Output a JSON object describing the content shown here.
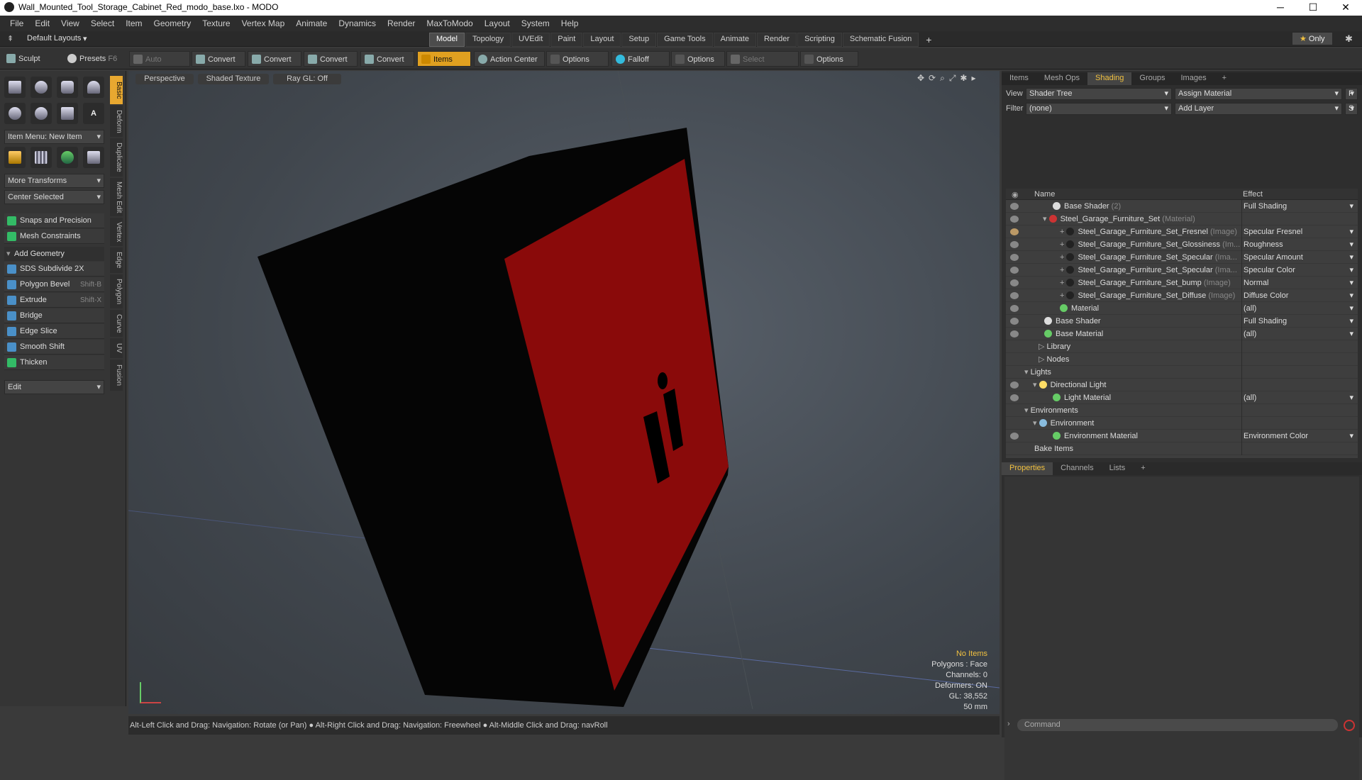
{
  "window": {
    "title": "Wall_Mounted_Tool_Storage_Cabinet_Red_modo_base.lxo - MODO",
    "minimize": "─",
    "maximize": "☐",
    "close": "✕"
  },
  "menubar": [
    "File",
    "Edit",
    "View",
    "Select",
    "Item",
    "Geometry",
    "Texture",
    "Vertex Map",
    "Animate",
    "Dynamics",
    "Render",
    "MaxToModo",
    "Layout",
    "System",
    "Help"
  ],
  "layoutbar": {
    "layouts_label": "Default Layouts",
    "tabs": [
      "Model",
      "Topology",
      "UVEdit",
      "Paint",
      "Layout",
      "Setup",
      "Game Tools",
      "Animate",
      "Render",
      "Scripting",
      "Schematic Fusion"
    ],
    "add": "+",
    "only": "Only"
  },
  "toolbar": {
    "sculpt": "Sculpt",
    "presets": "Presets",
    "presets_key": "F6",
    "auto_select": "Auto Select",
    "convert": "Convert",
    "items": "Items",
    "action_center": "Action Center",
    "options": "Options",
    "falloff": "Falloff",
    "select_through": "Select Through"
  },
  "leftpanel": {
    "vtabs": [
      "Basic",
      "Deform",
      "Duplicate",
      "Mesh Edit",
      "Vertex",
      "Edge",
      "Polygon",
      "Curve",
      "UV",
      "Fusion"
    ],
    "item_menu": "Item Menu: New Item",
    "more_transforms": "More Transforms",
    "center_selected": "Center Selected",
    "snaps": "Snaps and Precision",
    "mesh_constraints": "Mesh Constraints",
    "add_geometry": "Add Geometry",
    "tools": [
      {
        "label": "SDS Subdivide 2X",
        "key": ""
      },
      {
        "label": "Polygon Bevel",
        "key": "Shift-B"
      },
      {
        "label": "Extrude",
        "key": "Shift-X"
      },
      {
        "label": "Bridge",
        "key": ""
      },
      {
        "label": "Edge Slice",
        "key": ""
      },
      {
        "label": "Smooth Shift",
        "key": ""
      },
      {
        "label": "Thicken",
        "key": ""
      }
    ],
    "edit": "Edit"
  },
  "viewport": {
    "perspective": "Perspective",
    "shading": "Shaded Texture",
    "raygl": "Ray GL: Off",
    "info": [
      "No Items",
      "Polygons : Face",
      "Channels: 0",
      "Deformers: ON",
      "GL: 38,552",
      "50 mm"
    ],
    "colors": {
      "cabinet_body": "#050505",
      "door": "#8a0a0a"
    }
  },
  "status": "Alt-Left Click and Drag: Navigation: Rotate (or Pan) ● Alt-Right Click and Drag: Navigation: Freewheel ● Alt-Middle Click and Drag: navRoll",
  "rightpanel": {
    "tabs": [
      "Items",
      "Mesh Ops",
      "Shading",
      "Groups",
      "Images",
      "+"
    ],
    "view_label": "View",
    "view_value": "Shader Tree",
    "assign": "Assign Material",
    "f": "F",
    "filter_label": "Filter",
    "filter_value": "(none)",
    "add_layer": "Add Layer",
    "s": "S",
    "col_name": "Name",
    "col_effect": "Effect",
    "rows": [
      {
        "name": "Base Shader",
        "sub": "(2)",
        "effect": "Full Shading",
        "ball": "#ddd"
      },
      {
        "name": "Steel_Garage_Furniture_Set",
        "sub": "(Material)",
        "effect": "",
        "ball": "#c33"
      },
      {
        "name": "Steel_Garage_Furniture_Set_Fresnel",
        "sub": "(Image)",
        "effect": "Specular Fresnel",
        "ball": "#222"
      },
      {
        "name": "Steel_Garage_Furniture_Set_Glossiness",
        "sub": "(Im...",
        "effect": "Roughness",
        "ball": "#222"
      },
      {
        "name": "Steel_Garage_Furniture_Set_Specular",
        "sub": "(Ima...",
        "effect": "Specular Amount",
        "ball": "#222"
      },
      {
        "name": "Steel_Garage_Furniture_Set_Specular",
        "sub": "(Ima...",
        "effect": "Specular Color",
        "ball": "#222"
      },
      {
        "name": "Steel_Garage_Furniture_Set_bump",
        "sub": "(Image)",
        "effect": "Normal",
        "ball": "#222"
      },
      {
        "name": "Steel_Garage_Furniture_Set_Diffuse",
        "sub": "(Image)",
        "effect": "Diffuse Color",
        "ball": "#222"
      },
      {
        "name": "Material",
        "sub": "",
        "effect": "(all)",
        "ball": "#6c6"
      },
      {
        "name": "Base Shader",
        "sub": "",
        "effect": "Full Shading",
        "ball": "#ddd"
      },
      {
        "name": "Base Material",
        "sub": "",
        "effect": "(all)",
        "ball": "#6c6"
      },
      {
        "name": "Library",
        "sub": "",
        "effect": "",
        "ball": ""
      },
      {
        "name": "Nodes",
        "sub": "",
        "effect": "",
        "ball": ""
      },
      {
        "name": "Lights",
        "sub": "",
        "effect": "",
        "ball": ""
      },
      {
        "name": "Directional Light",
        "sub": "",
        "effect": "",
        "ball": "#fd6"
      },
      {
        "name": "Light Material",
        "sub": "",
        "effect": "(all)",
        "ball": "#6c6"
      },
      {
        "name": "Environments",
        "sub": "",
        "effect": "",
        "ball": ""
      },
      {
        "name": "Environment",
        "sub": "",
        "effect": "",
        "ball": "#8bd"
      },
      {
        "name": "Environment Material",
        "sub": "",
        "effect": "Environment Color",
        "ball": "#6c6"
      },
      {
        "name": "Bake Items",
        "sub": "",
        "effect": "",
        "ball": ""
      }
    ],
    "prop_tabs": [
      "Properties",
      "Channels",
      "Lists",
      "+"
    ],
    "command_placeholder": "Command"
  }
}
